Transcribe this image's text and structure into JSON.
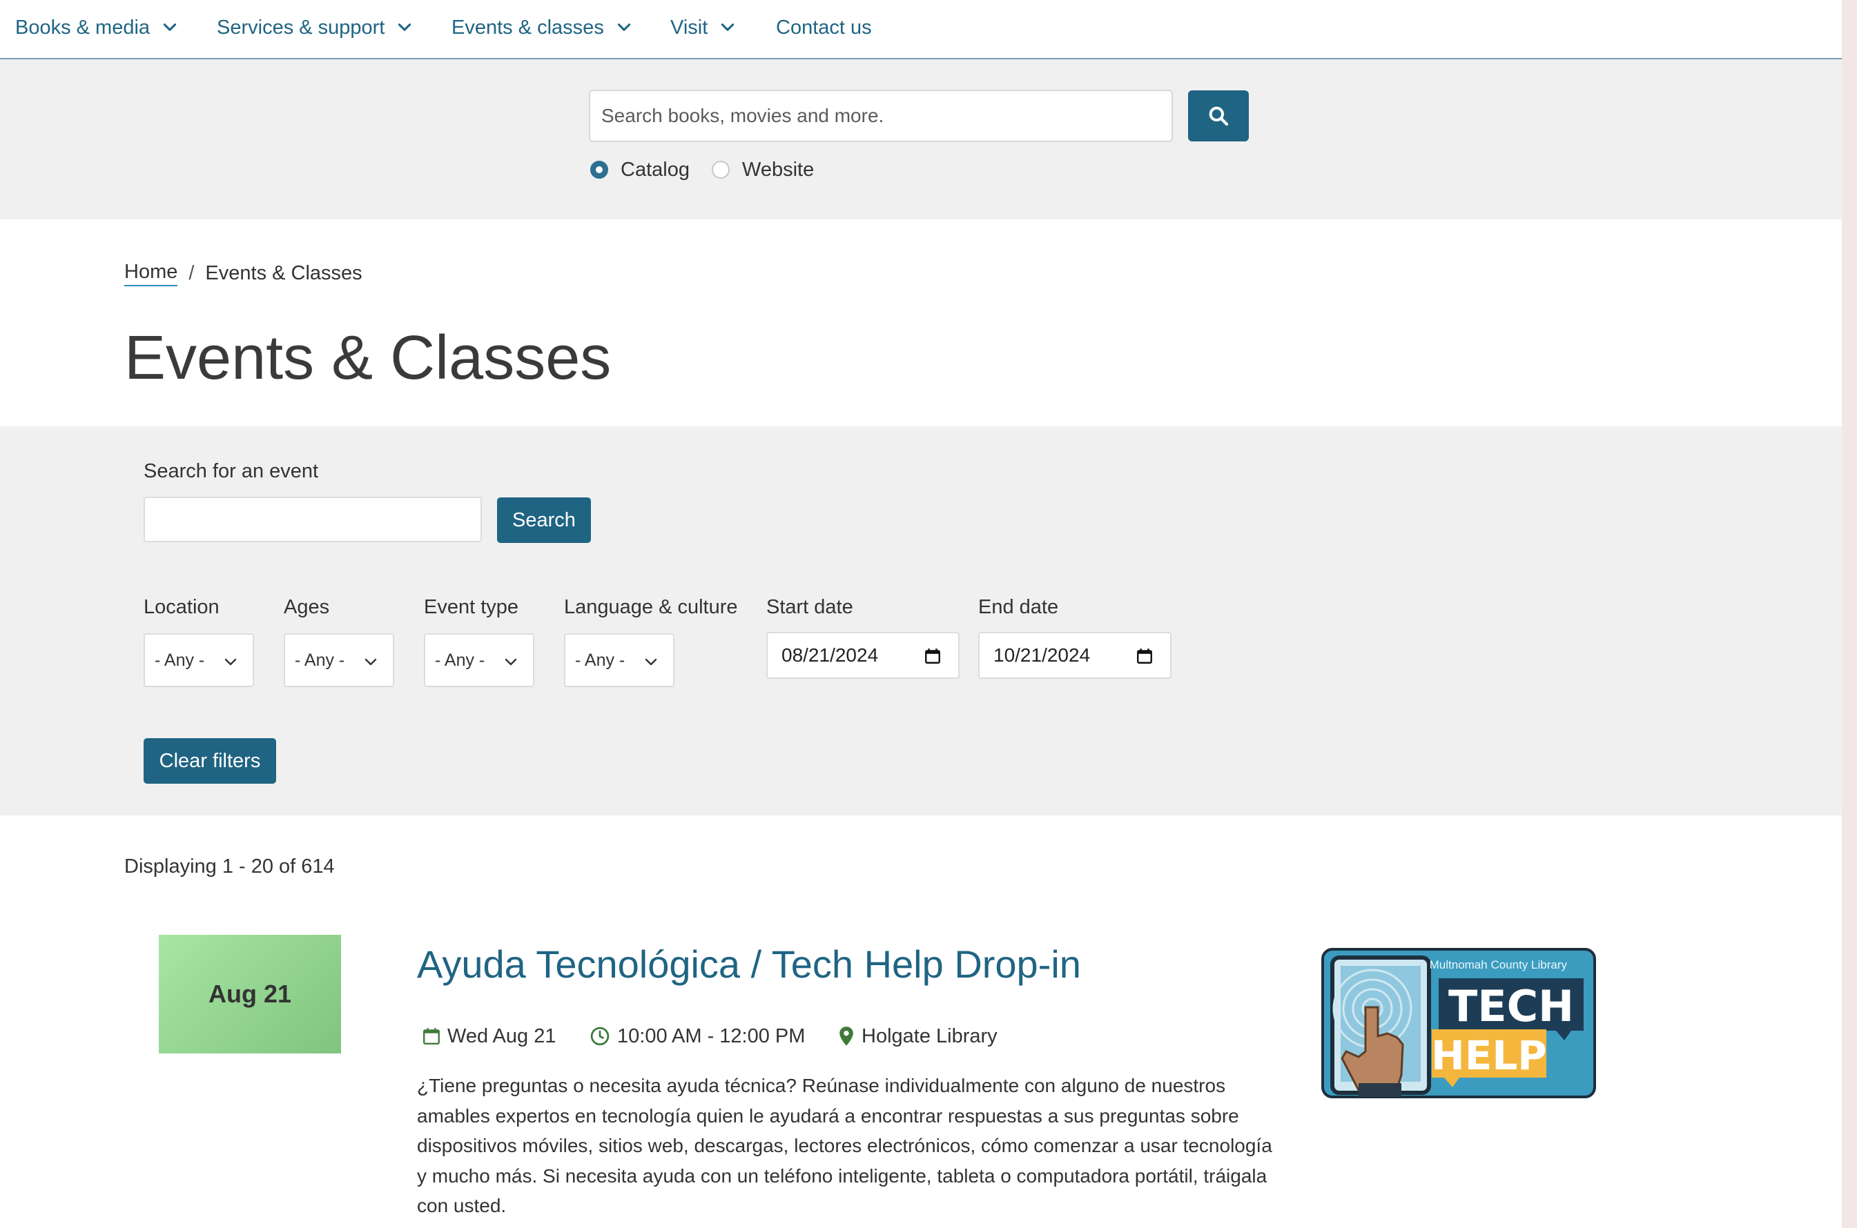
{
  "nav": {
    "items": [
      {
        "label": "Books & media",
        "has_dropdown": true
      },
      {
        "label": "Services & support",
        "has_dropdown": true
      },
      {
        "label": "Events & classes",
        "has_dropdown": true
      },
      {
        "label": "Visit",
        "has_dropdown": true
      },
      {
        "label": "Contact us",
        "has_dropdown": false
      }
    ]
  },
  "site_search": {
    "placeholder": "Search books, movies and more.",
    "button_icon": "search-icon",
    "scope_options": [
      {
        "label": "Catalog",
        "selected": true
      },
      {
        "label": "Website",
        "selected": false
      }
    ]
  },
  "breadcrumb": {
    "home": "Home",
    "separator": "/",
    "current": "Events & Classes"
  },
  "page_title": "Events & Classes",
  "filters": {
    "search_label": "Search for an event",
    "search_value": "",
    "search_button": "Search",
    "location": {
      "label": "Location",
      "value": "- Any -"
    },
    "ages": {
      "label": "Ages",
      "value": "- Any -"
    },
    "event_type": {
      "label": "Event type",
      "value": "- Any -"
    },
    "language": {
      "label": "Language & culture",
      "value": "- Any -"
    },
    "start_date": {
      "label": "Start date",
      "value": "08/21/2024"
    },
    "end_date": {
      "label": "End date",
      "value": "10/21/2024"
    },
    "clear_button": "Clear filters"
  },
  "results": {
    "count_text": "Displaying 1 - 20 of 614",
    "events": [
      {
        "date_tile": "Aug 21",
        "title": "Ayuda Tecnológica / Tech Help Drop-in",
        "day": "Wed Aug 21",
        "time": "10:00 AM - 12:00 PM",
        "location": "Holgate Library",
        "description": "¿Tiene preguntas o necesita ayuda técnica? Reúnase individualmente con alguno de nuestros amables expertos en tecnología quien le ayudará a encontrar respuestas a sus preguntas sobre dispositivos móviles, sitios web, descargas, lectores electrónicos, cómo comenzar a usar tecnología y mucho más. Si necesita ayuda con un teléfono inteligente, tableta o computadora portátil, tráigala con usted.",
        "image": {
          "org_text": "Multnomah County Library",
          "word1": "TECH",
          "word2": "HELP"
        }
      }
    ]
  },
  "colors": {
    "brand": "#1f6483",
    "panel": "#f0f0f0",
    "meta_icon": "#3f7a3a"
  }
}
